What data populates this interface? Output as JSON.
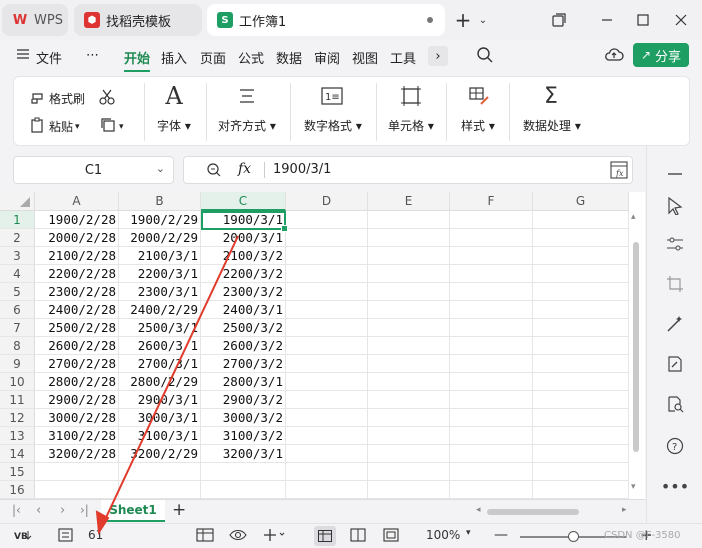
{
  "tabs": {
    "wps": "WPS",
    "template": "找稻壳模板",
    "workbook": "工作簿1"
  },
  "menu": {
    "file": "文件",
    "more": "⋯",
    "items": [
      "开始",
      "插入",
      "页面",
      "公式",
      "数据",
      "审阅",
      "视图",
      "工具"
    ],
    "share": "分享"
  },
  "ribbon": {
    "format_painter": "格式刷",
    "paste": "粘贴",
    "font": "字体",
    "align": "对齐方式",
    "number_format": "数字格式",
    "cells": "单元格",
    "style": "样式",
    "data_process": "数据处理"
  },
  "formula_bar": {
    "name_box": "C1",
    "fx": "fx",
    "formula": "1900/3/1"
  },
  "grid": {
    "columns": [
      "A",
      "B",
      "C",
      "D",
      "E",
      "F",
      "G"
    ],
    "rows": [
      "1",
      "2",
      "3",
      "4",
      "5",
      "6",
      "7",
      "8",
      "9",
      "10",
      "11",
      "12",
      "13",
      "14",
      "15",
      "16"
    ],
    "selected_col": "C",
    "selected_row": "1",
    "col_a": [
      "1900/2/28",
      "2000/2/28",
      "2100/2/28",
      "2200/2/28",
      "2300/2/28",
      "2400/2/28",
      "2500/2/28",
      "2600/2/28",
      "2700/2/28",
      "2800/2/28",
      "2900/2/28",
      "3000/2/28",
      "3100/2/28",
      "3200/2/28"
    ],
    "col_b": [
      "1900/2/29",
      "2000/2/29",
      "2100/3/1",
      "2200/3/1",
      "2300/3/1",
      "2400/2/29",
      "2500/3/1",
      "2600/3/1",
      "2700/3/1",
      "2800/2/29",
      "2900/3/1",
      "3000/3/1",
      "3100/3/1",
      "3200/2/29"
    ],
    "col_c": [
      "1900/3/1",
      "2000/3/1",
      "2100/3/2",
      "2200/3/2",
      "2300/3/2",
      "2400/3/1",
      "2500/3/2",
      "2600/3/2",
      "2700/3/2",
      "2800/3/1",
      "2900/3/2",
      "3000/3/2",
      "3100/3/2",
      "3200/3/1"
    ]
  },
  "sheets": {
    "active": "Sheet1",
    "add": "+"
  },
  "status": {
    "count": "61",
    "zoom": "100%",
    "watermark": "CSDN @F-3580"
  },
  "colors": {
    "accent": "#1e9e62",
    "annotation_arrow": "#e03b2c"
  }
}
